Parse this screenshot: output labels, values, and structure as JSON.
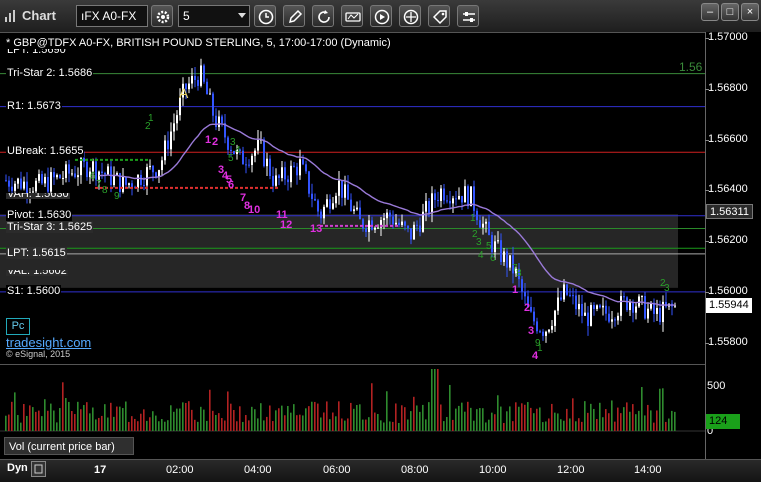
{
  "window": {
    "title": "Chart",
    "symbol_value": "ıFX A0-FX",
    "interval_value": "5"
  },
  "legend": "* GBP@TDFX A0-FX, BRITISH POUND STERLING, 5, 17:00-17:00 (Dynamic)",
  "levels": [
    {
      "key": "tristar2",
      "label": "Tri-Star 2: 1.5686",
      "value": 1.5686,
      "color": "#3a8a3a"
    },
    {
      "key": "r1",
      "label": "R1: 1.5673",
      "value": 1.5673,
      "color": "#3030d0"
    },
    {
      "key": "ubreak",
      "label": "UBreak: 1.5655",
      "value": 1.5655,
      "color": "#d02020"
    },
    {
      "key": "pivot",
      "label": "Pivot: 1.5630",
      "value": 1.563,
      "color": "#3030d0"
    },
    {
      "key": "tristar3",
      "label": "Tri-Star 3: 1.5625",
      "value": 1.5625,
      "color": "#2a8a2a"
    },
    {
      "key": "lpt",
      "label": "LPT: 1.5615",
      "value": 1.5615,
      "color": "#aaaaaa"
    },
    {
      "key": "s1",
      "label": "S1: 1.5600",
      "value": 1.56,
      "color": "#3030d0"
    }
  ],
  "partial_labels": {
    "top": "LPT: 1.5690",
    "mid": "VAH: 1.5630",
    "low": "VAL: 1.5602",
    "right_green": "1.56"
  },
  "marker_a": "A",
  "y_axis": {
    "ticks": [
      "1.57000",
      "1.56800",
      "1.56600",
      "1.56400",
      "1.56200",
      "1.56000",
      "1.55800"
    ],
    "min": 1.5572,
    "max": 1.5702
  },
  "price_tags": {
    "ma": "1.56311",
    "last": "1.55944"
  },
  "volume": {
    "label": "Vol (current price bar)",
    "ticks": [
      "500",
      "0"
    ],
    "last": "124"
  },
  "x_axis": {
    "labels": [
      "17",
      "02:00",
      "04:00",
      "06:00",
      "08:00",
      "10:00",
      "12:00",
      "14:00"
    ]
  },
  "bottom": {
    "mode": "Dyn"
  },
  "branding": {
    "pc": "Pc",
    "site": "tradesight.com",
    "copyright": "© eSignal, 2015"
  },
  "counts": {
    "magenta": [
      "1",
      "2",
      "3",
      "4",
      "5",
      "6",
      "7",
      "8",
      "10",
      "11",
      "12",
      "13",
      "1",
      "2",
      "3",
      "4"
    ],
    "green": [
      "1",
      "2",
      "3",
      "4",
      "5",
      "6",
      "7",
      "8",
      "9",
      "1",
      "2",
      "3",
      "4",
      "5",
      "6",
      "7",
      "8",
      "9",
      "1",
      "2",
      "3"
    ]
  },
  "colors": {
    "up": "#ffffff",
    "down": "#3355ff",
    "ma": "#9a7ad8",
    "volume_up": "#2e8b2e",
    "volume_down": "#b22222",
    "accent": "#2255ff"
  }
}
